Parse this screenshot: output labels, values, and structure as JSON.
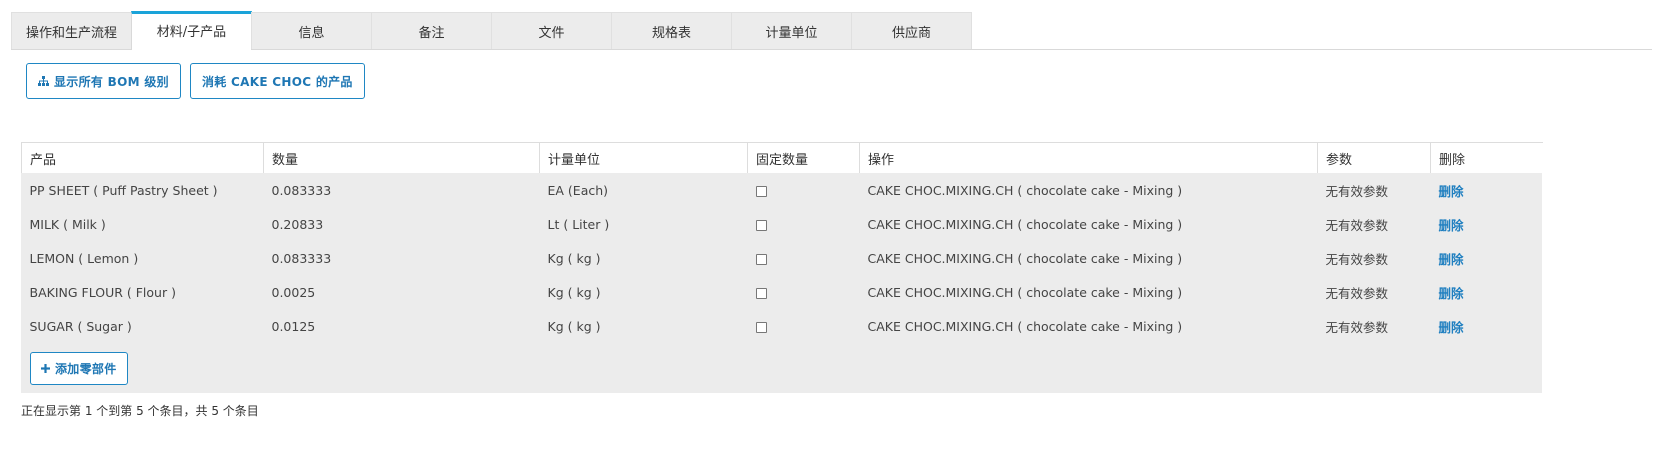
{
  "tabs": [
    {
      "label": "操作和生产流程",
      "active": false
    },
    {
      "label": "材料/子产品",
      "active": true
    },
    {
      "label": "信息",
      "active": false
    },
    {
      "label": "备注",
      "active": false
    },
    {
      "label": "文件",
      "active": false
    },
    {
      "label": "规格表",
      "active": false
    },
    {
      "label": "计量单位",
      "active": false
    },
    {
      "label": "供应商",
      "active": false
    }
  ],
  "actions": {
    "show_bom_label": "显示所有 BOM 级别",
    "consume_label": "消耗 CAKE CHOC 的产品",
    "add_part_label": "添加零部件"
  },
  "table": {
    "headers": [
      "产品",
      "数量",
      "计量单位",
      "固定数量",
      "操作",
      "参数",
      "删除"
    ],
    "rows": [
      {
        "product": "PP SHEET ( Puff Pastry Sheet )",
        "qty": "0.083333",
        "uom": "EA (Each)",
        "fixed": false,
        "operation": "CAKE CHOC.MIXING.CH ( chocolate cake - Mixing )",
        "params": "无有效参数",
        "delete": "删除"
      },
      {
        "product": "MILK ( Milk )",
        "qty": "0.20833",
        "uom": "Lt ( Liter )",
        "fixed": false,
        "operation": "CAKE CHOC.MIXING.CH ( chocolate cake - Mixing )",
        "params": "无有效参数",
        "delete": "删除"
      },
      {
        "product": "LEMON ( Lemon )",
        "qty": "0.083333",
        "uom": "Kg ( kg )",
        "fixed": false,
        "operation": "CAKE CHOC.MIXING.CH ( chocolate cake - Mixing )",
        "params": "无有效参数",
        "delete": "删除"
      },
      {
        "product": "BAKING FLOUR ( Flour )",
        "qty": "0.0025",
        "uom": "Kg ( kg )",
        "fixed": false,
        "operation": "CAKE CHOC.MIXING.CH ( chocolate cake - Mixing )",
        "params": "无有效参数",
        "delete": "删除"
      },
      {
        "product": "SUGAR ( Sugar )",
        "qty": "0.0125",
        "uom": "Kg ( kg )",
        "fixed": false,
        "operation": "CAKE CHOC.MIXING.CH ( chocolate cake - Mixing )",
        "params": "无有效参数",
        "delete": "删除"
      }
    ]
  },
  "pagination_info": "正在显示第 1 个到第 5 个条目，共 5 个条目",
  "colors": {
    "accent": "#1aa3d9",
    "link": "#1f7fc0",
    "row_bg": "#ececec"
  },
  "icons": {
    "bom_icon": "sitemap-icon",
    "add_icon": "plus-icon"
  }
}
